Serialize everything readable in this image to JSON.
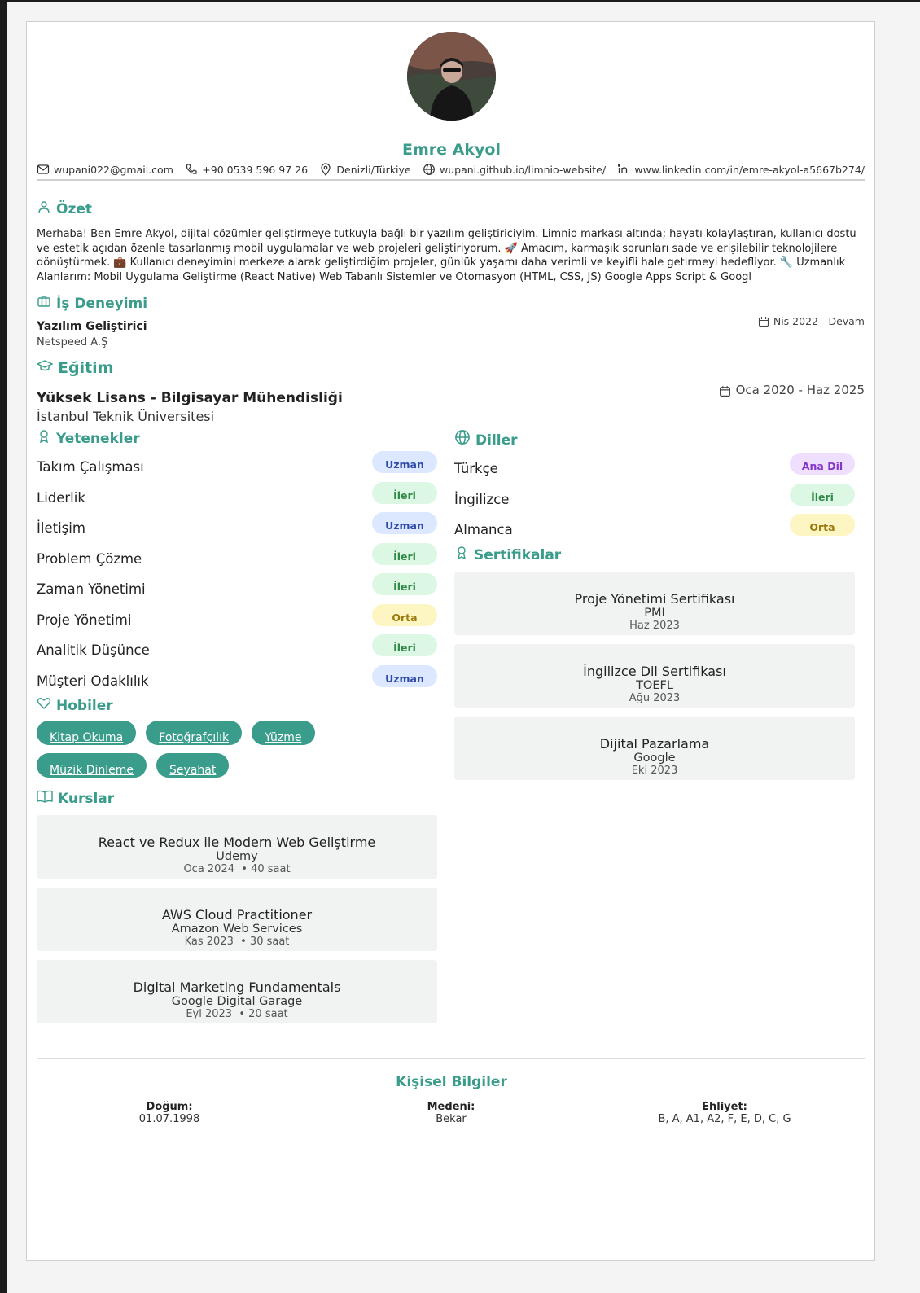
{
  "header": {
    "name": "Emre Akyol",
    "contacts": {
      "email": "wupani022@gmail.com",
      "phone": "+90 0539 596 97 26",
      "location": "Denizli/Türkiye",
      "website": "wupani.github.io/limnio-website/",
      "linkedin": "www.linkedin.com/in/emre-akyol-a5667b274/"
    }
  },
  "summary": {
    "title": "Özet",
    "text": "Merhaba! Ben Emre Akyol, dijital çözümler geliştirmeye tutkuyla bağlı bir yazılım geliştiriciyim. Limnio markası altında; hayatı kolaylaştıran, kullanıcı dostu ve estetik açıdan özenle tasarlanmış mobil uygulamalar ve web projeleri geliştiriyorum. 🚀 Amacım, karmaşık sorunları sade ve erişilebilir teknolojilere dönüştürmek. 💼 Kullanıcı deneyimini merkeze alarak geliştirdiğim projeler, günlük yaşamı daha verimli ve keyifli hale getirmeyi hedefliyor. 🔧 Uzmanlık Alanlarım: Mobil Uygulama Geliştirme (React Native) Web Tabanlı Sistemler ve Otomasyon (HTML, CSS, JS) Google Apps Script & Googl"
  },
  "experience": {
    "title": "İş Deneyimi",
    "job_title": "Yazılım Geliştirici",
    "company": "Netspeed A.Ş",
    "date": "Nis 2022 - Devam"
  },
  "education": {
    "title": "Eğitim",
    "degree": "Yüksek Lisans - Bilgisayar Mühendisliği",
    "school": "İstanbul Teknik Üniversitesi",
    "date": "Oca 2020 - Haz 2025"
  },
  "skills": {
    "title": "Yetenekler",
    "items": [
      {
        "name": "Takım Çalışması",
        "level": "Uzman"
      },
      {
        "name": "Liderlik",
        "level": "İleri"
      },
      {
        "name": "İletişim",
        "level": "Uzman"
      },
      {
        "name": "Problem Çözme",
        "level": "İleri"
      },
      {
        "name": "Zaman Yönetimi",
        "level": "İleri"
      },
      {
        "name": "Proje Yönetimi",
        "level": "Orta"
      },
      {
        "name": "Analitik Düşünce",
        "level": "İleri"
      },
      {
        "name": "Müşteri Odaklılık",
        "level": "Uzman"
      }
    ]
  },
  "hobbies": {
    "title": "Hobiler",
    "items": [
      "Kitap Okuma",
      "Fotoğrafçılık",
      "Yüzme",
      "Müzik Dinleme",
      "Seyahat"
    ]
  },
  "courses": {
    "title": "Kurslar",
    "items": [
      {
        "name": "React ve Redux ile Modern Web Geliştirme",
        "provider": "Udemy",
        "date": "Oca 2024",
        "duration": "• 40 saat"
      },
      {
        "name": "AWS Cloud Practitioner",
        "provider": "Amazon Web Services",
        "date": "Kas 2023",
        "duration": "• 30 saat"
      },
      {
        "name": "Digital Marketing Fundamentals",
        "provider": "Google Digital Garage",
        "date": "Eyl 2023",
        "duration": "• 20 saat"
      }
    ]
  },
  "languages": {
    "title": "Diller",
    "items": [
      {
        "name": "Türkçe",
        "level": "Ana Dil"
      },
      {
        "name": "İngilizce",
        "level": "İleri"
      },
      {
        "name": "Almanca",
        "level": "Orta"
      }
    ]
  },
  "certificates": {
    "title": "Sertifikalar",
    "items": [
      {
        "name": "Proje Yönetimi Sertifikası",
        "issuer": "PMI",
        "date": "Haz 2023"
      },
      {
        "name": "İngilizce Dil Sertifikası",
        "issuer": "TOEFL",
        "date": "Ağu 2023"
      },
      {
        "name": "Dijital Pazarlama",
        "issuer": "Google",
        "date": "Eki 2023"
      }
    ]
  },
  "personal": {
    "title": "Kişisel Bilgiler",
    "birth_label": "Doğum:",
    "birth_value": "01.07.1998",
    "marital_label": "Medeni:",
    "marital_value": "Bekar",
    "license_label": "Ehliyet:",
    "license_value": "B, A, A1, A2, F, E, D, C, G"
  },
  "colors": {
    "accent": "#3a9c8a",
    "badge_expert": "#dbe8ff",
    "badge_advanced": "#dcf7e3",
    "badge_intermediate": "#fdf6c2",
    "badge_native": "#efdfff"
  }
}
